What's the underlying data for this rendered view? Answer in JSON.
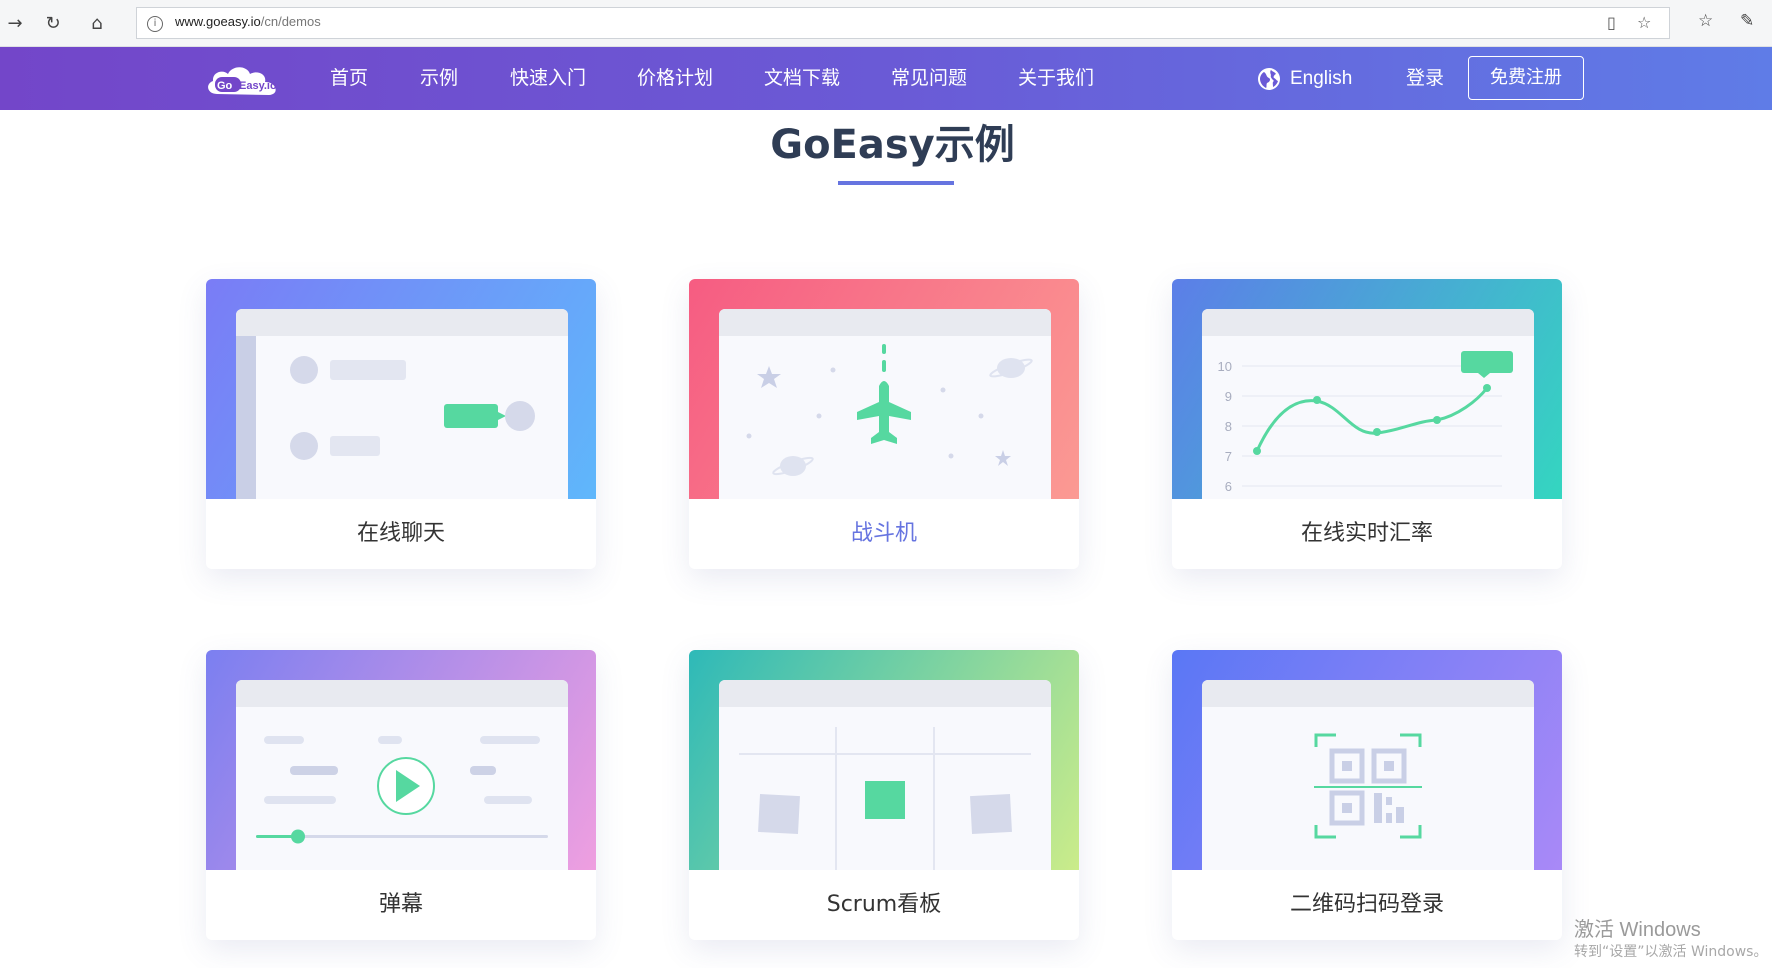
{
  "browser": {
    "url_host": "www.goeasy.io",
    "url_path": "/cn/demos"
  },
  "header": {
    "logo_text": "GoEasy.io",
    "nav": [
      "首页",
      "示例",
      "快速入门",
      "价格计划",
      "文档下载",
      "常见问题",
      "关于我们"
    ],
    "language": "English",
    "login": "登录",
    "register": "免费注册"
  },
  "page": {
    "title": "GoEasy示例"
  },
  "cards": [
    {
      "label": "在线聊天",
      "gradient": [
        "#7a7cf6",
        "#5fb7fb"
      ]
    },
    {
      "label": "战斗机",
      "gradient": [
        "#f65c82",
        "#fb9a93"
      ],
      "label_color": "#6674e0"
    },
    {
      "label": "在线实时汇率",
      "gradient": [
        "#5c7ee8",
        "#34d6c0"
      ],
      "chart": {
        "y_ticks": [
          "10",
          "9",
          "8",
          "7",
          "6"
        ]
      }
    },
    {
      "label": "弹幕",
      "gradient": [
        "#7b7ff0",
        "#ef9fe0"
      ]
    },
    {
      "label": "Scrum看板",
      "gradient": [
        "#2eb9b8",
        "#cbec8a"
      ]
    },
    {
      "label": "二维码扫码登录",
      "gradient": [
        "#5a77f5",
        "#a989f7"
      ]
    }
  ],
  "watermark": {
    "line1": "激活 Windows",
    "line2": "转到“设置”以激活 Windows。"
  },
  "colors": {
    "accent": "#6674e0",
    "green": "#56d8a0",
    "header_start": "#7346c9",
    "header_end": "#5f7ce7"
  }
}
